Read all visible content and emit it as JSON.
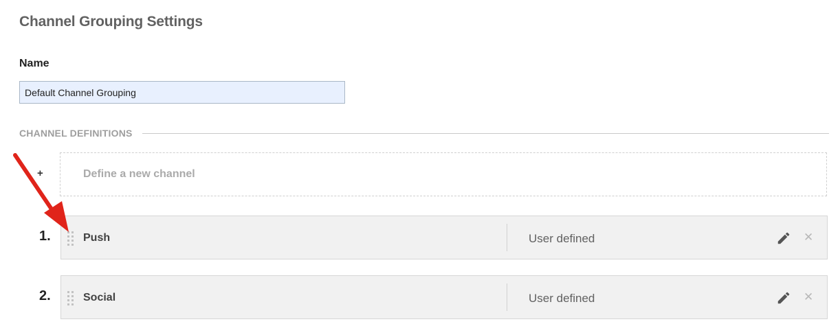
{
  "page": {
    "title": "Channel Grouping Settings"
  },
  "name_field": {
    "label": "Name",
    "value": "Default Channel Grouping"
  },
  "channel_definitions": {
    "section_label": "CHANNEL DEFINITIONS",
    "add_symbol": "+",
    "define_new_label": "Define a new channel",
    "channels": [
      {
        "index": "1.",
        "name": "Push",
        "type": "User defined"
      },
      {
        "index": "2.",
        "name": "Social",
        "type": "User defined"
      }
    ]
  },
  "icons": {
    "drag_handle": "drag-handle-icon",
    "edit": "pencil-icon",
    "remove": "close-icon",
    "annotation": "red-arrow"
  },
  "colors": {
    "annotation_arrow": "#e0241a",
    "input_background": "#e8f0fe",
    "row_background": "#f1f1f1"
  }
}
